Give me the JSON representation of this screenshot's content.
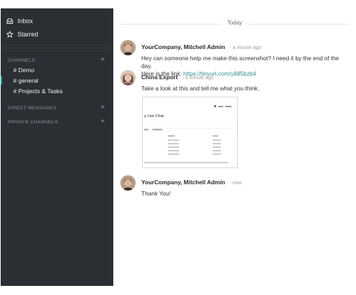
{
  "sidebar": {
    "inbox": "Inbox",
    "starred": "Starred",
    "channels_header": "CHANNELS",
    "channels": [
      {
        "label": "# Demo"
      },
      {
        "label": "# general"
      },
      {
        "label": "# Projects & Tasks"
      }
    ],
    "direct_messages_header": "DIRECT MESSAGES",
    "private_channels_header": "PRIVATE CHANNELS",
    "add": "+"
  },
  "main": {
    "day_separator": "Today",
    "messages": [
      {
        "author": "YourCompany, Mitchell Admin",
        "time": "- a minute ago",
        "text": "Hey can someone help me make this screenshot? I need it by the end of the day.",
        "text2": "Here is the link: ",
        "link": "https://tinyurl.com/y885bzb4"
      },
      {
        "author": "China Export",
        "time": "- a minute ago",
        "text": "Take a look at this and tell me what you think.",
        "attachment_title": "y Live Chat"
      },
      {
        "author": "YourCompany, Mitchell Admin",
        "time": "- now",
        "text": "Thank You!"
      }
    ]
  },
  "colors": {
    "sidebar_bg": "#2b2f33",
    "accent": "#00a09d",
    "link": "#2a8f8c"
  }
}
